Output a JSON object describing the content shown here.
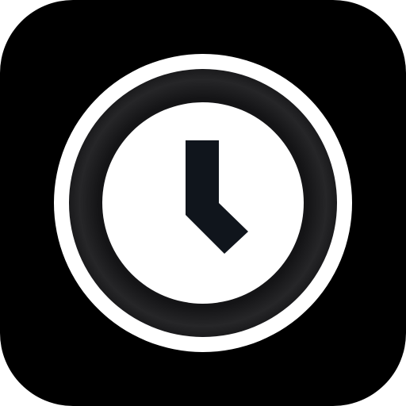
{
  "icon": {
    "name": "clock-icon",
    "colors": {
      "tile": "#000000",
      "outer_ring": "#ffffff",
      "bezel": "#1c1c1e",
      "face": "#ffffff",
      "hands": "#10151c"
    }
  }
}
